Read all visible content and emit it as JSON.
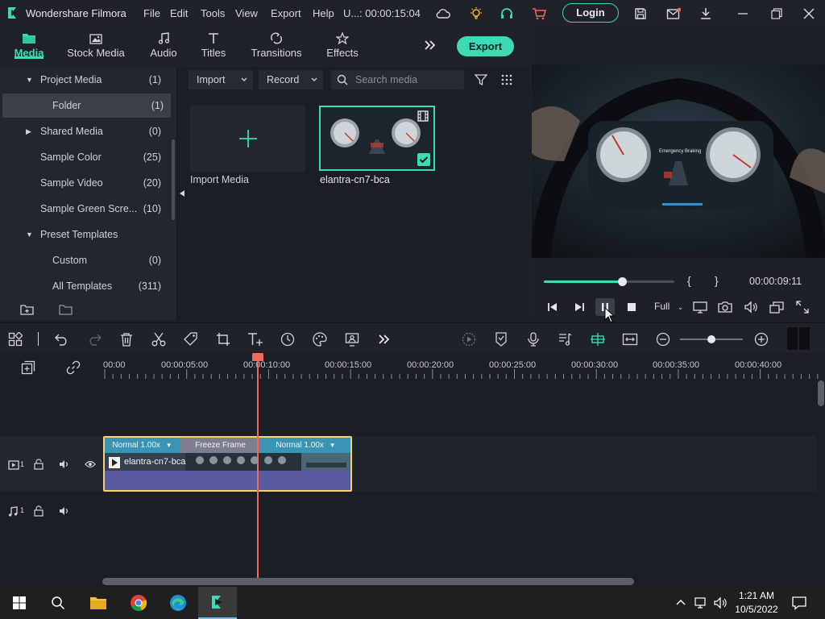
{
  "app": {
    "title": "Wondershare Filmora",
    "menu": [
      "File",
      "Edit",
      "Tools",
      "View",
      "Export",
      "Help"
    ],
    "project_name": "U...",
    "duration": ": 00:00:15:04",
    "login_label": "Login"
  },
  "nav_tabs": [
    {
      "label": "Media",
      "icon": "media-folder-icon",
      "active": true
    },
    {
      "label": "Stock Media",
      "icon": "stock-media-icon",
      "active": false
    },
    {
      "label": "Audio",
      "icon": "music-note-icon",
      "active": false
    },
    {
      "label": "Titles",
      "icon": "text-t-icon",
      "active": false
    },
    {
      "label": "Transitions",
      "icon": "transition-icon",
      "active": false
    },
    {
      "label": "Effects",
      "icon": "effects-star-icon",
      "active": false
    }
  ],
  "export_label": "Export",
  "tree": [
    {
      "label": "Project Media",
      "count": "(1)",
      "expanded": true
    },
    {
      "label": "Folder",
      "count": "(1)",
      "selected": true
    },
    {
      "label": "Shared Media",
      "count": "(0)",
      "expanded": false
    },
    {
      "label": "Sample Color",
      "count": "(25)"
    },
    {
      "label": "Sample Video",
      "count": "(20)"
    },
    {
      "label": "Sample Green Scre...",
      "count": "(10)"
    },
    {
      "label": "Preset Templates",
      "count": "",
      "expanded": true
    },
    {
      "label": "Custom",
      "count": "(0)"
    },
    {
      "label": "All Templates",
      "count": "(311)"
    }
  ],
  "media_toolbar": {
    "import_label": "Import",
    "record_label": "Record",
    "search_placeholder": "Search media"
  },
  "media_items": [
    {
      "label": "Import Media"
    },
    {
      "label": "elantra-cn7-bca"
    }
  ],
  "preview": {
    "dash_text": "Emergency Braking",
    "timecode": "00:00:09:11",
    "progress": 0.6,
    "zoom": "Full",
    "mark_in": "{",
    "mark_out": "}"
  },
  "ruler": [
    "00:00",
    "00:00:05:00",
    "00:00:10:00",
    "00:00:15:00",
    "00:00:20:00",
    "00:00:25:00",
    "00:00:30:00",
    "00:00:35:00",
    "00:00:40:00"
  ],
  "tracks": {
    "video_label": "1",
    "audio_label": "1"
  },
  "clip": {
    "name": "elantra-cn7-bca",
    "segments": [
      "Normal 1.00x",
      "Freeze Frame",
      "Normal 1.00x"
    ]
  },
  "taskbar": {
    "time": "1:21 AM",
    "date": "10/5/2022"
  },
  "colors": {
    "accent": "#3ddbb4",
    "playhead": "#f0695f",
    "clip_border": "#f3d272"
  }
}
